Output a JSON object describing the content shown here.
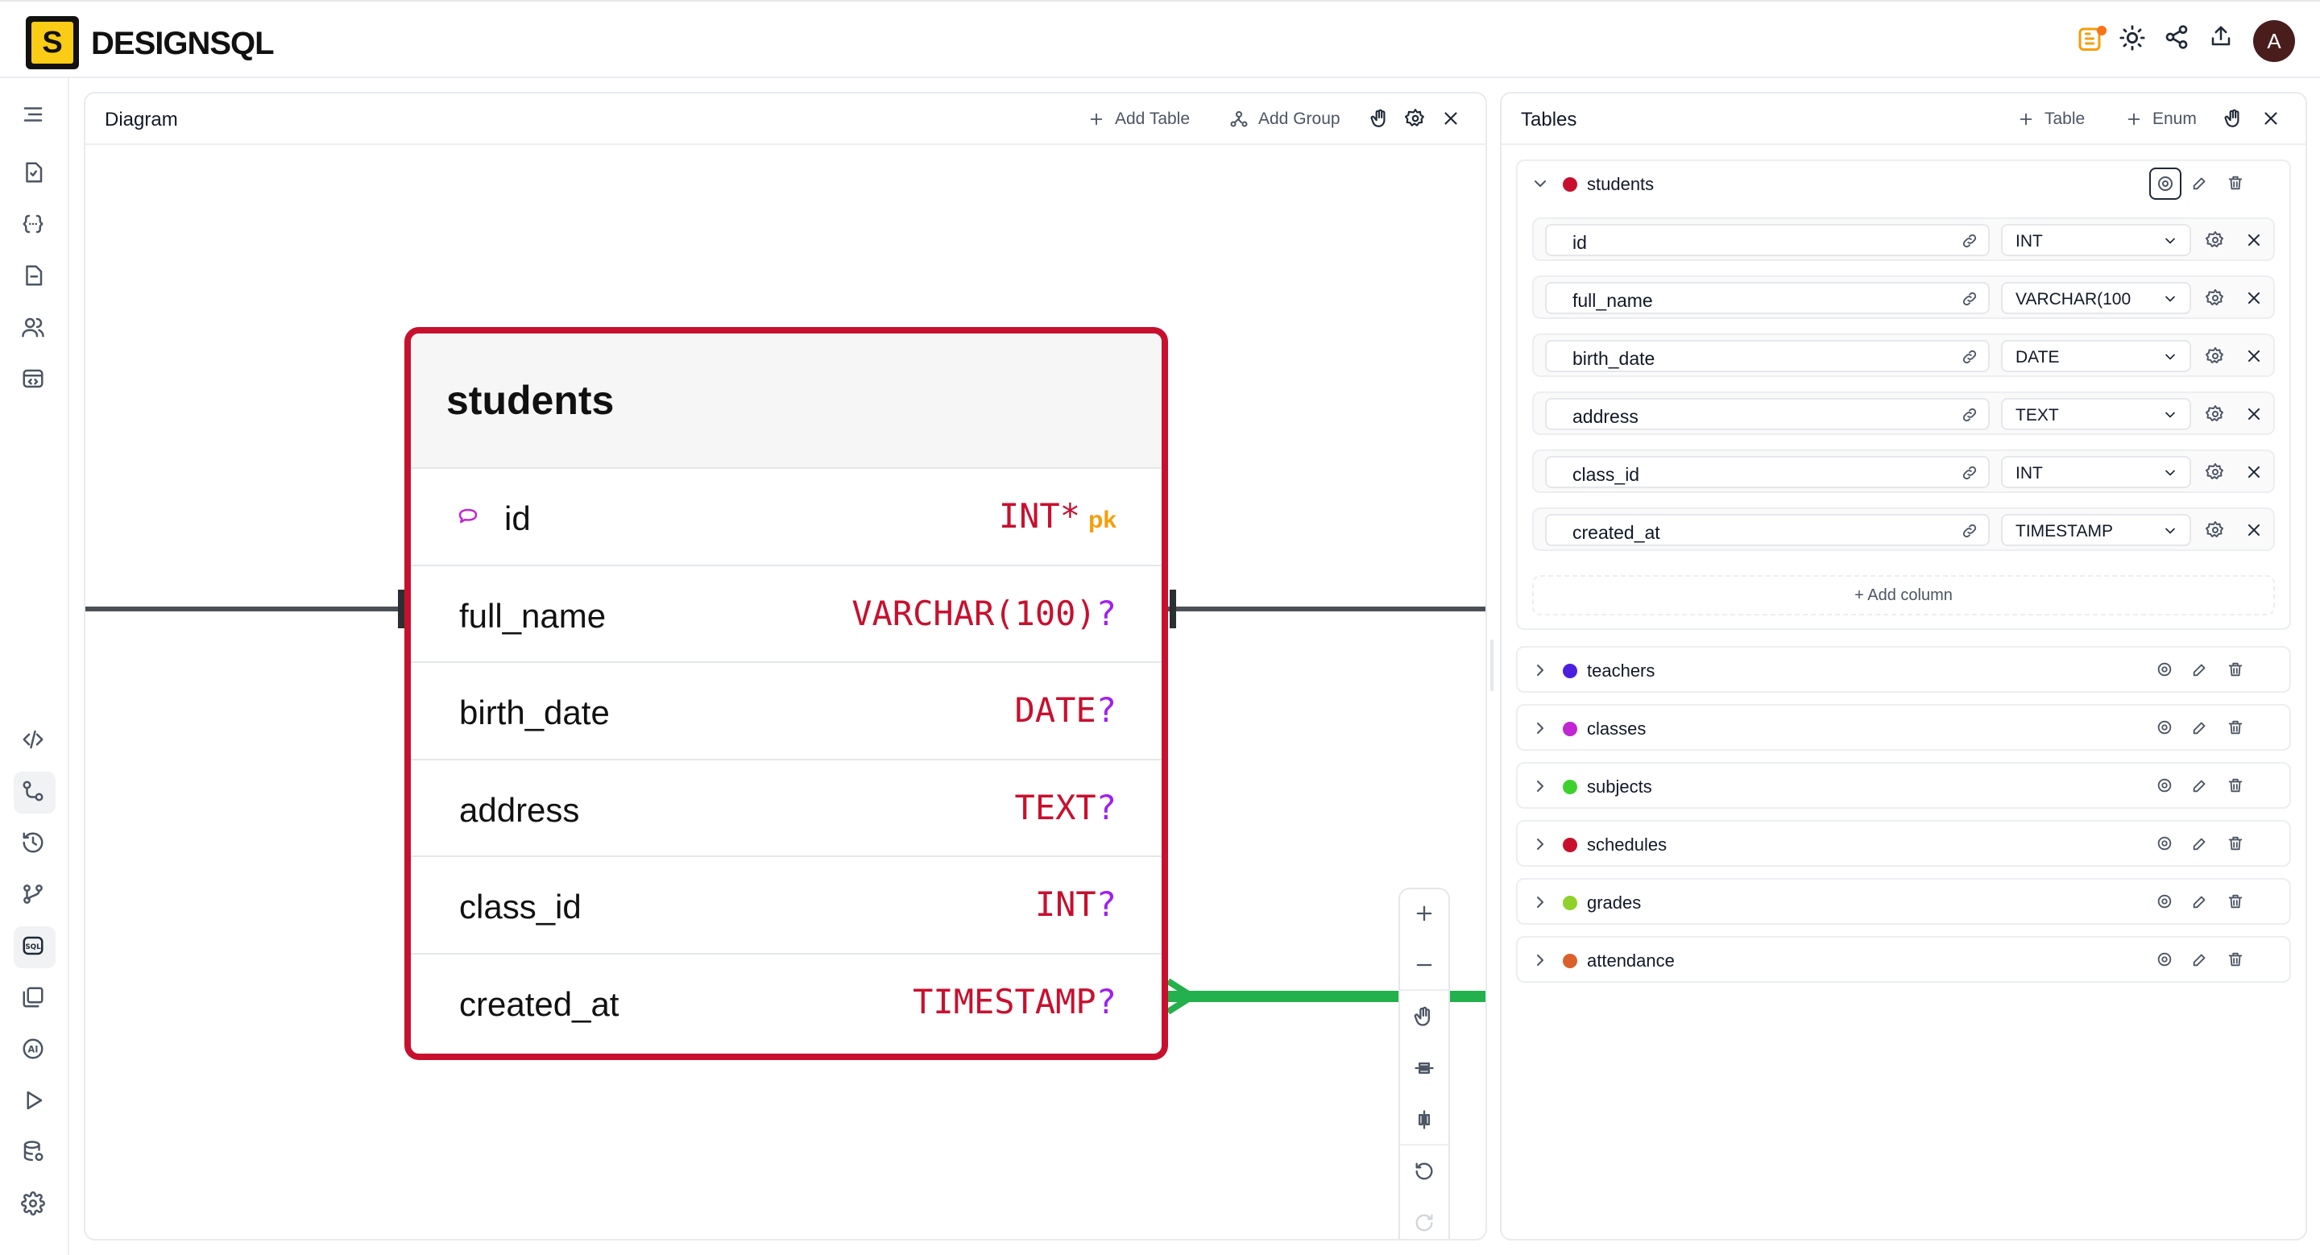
{
  "app": {
    "logo_letter": "S",
    "logo_text": "DESIGNSQL",
    "avatar": "A"
  },
  "diagram": {
    "title": "Diagram",
    "add_table": "Add Table",
    "add_group": "Add Group",
    "table": {
      "name": "students",
      "columns": [
        {
          "name": "id",
          "type": "INT",
          "suffix": "*",
          "pk": "pk"
        },
        {
          "name": "full_name",
          "type": "VARCHAR(100)",
          "suffix": "?"
        },
        {
          "name": "birth_date",
          "type": "DATE",
          "suffix": "?"
        },
        {
          "name": "address",
          "type": "TEXT",
          "suffix": "?"
        },
        {
          "name": "class_id",
          "type": "INT",
          "suffix": "?"
        },
        {
          "name": "created_at",
          "type": "TIMESTAMP",
          "suffix": "?"
        }
      ]
    },
    "colors": {
      "table_border": "#c8102e",
      "relation_green": "#22b14c",
      "relation_gray": "#4b5056"
    }
  },
  "tables_panel": {
    "title": "Tables",
    "add_table": "Table",
    "add_enum": "Enum",
    "expanded": {
      "name": "students",
      "color": "#c8102e",
      "columns": [
        {
          "name": "id",
          "type": "INT"
        },
        {
          "name": "full_name",
          "type": "VARCHAR(100"
        },
        {
          "name": "birth_date",
          "type": "DATE"
        },
        {
          "name": "address",
          "type": "TEXT"
        },
        {
          "name": "class_id",
          "type": "INT"
        },
        {
          "name": "created_at",
          "type": "TIMESTAMP"
        }
      ],
      "add_column": "Add column"
    },
    "collapsed": [
      {
        "name": "teachers",
        "color": "#4c1ee0"
      },
      {
        "name": "classes",
        "color": "#c026d3"
      },
      {
        "name": "subjects",
        "color": "#3dd12e"
      },
      {
        "name": "schedules",
        "color": "#c8102e"
      },
      {
        "name": "grades",
        "color": "#8fd12a"
      },
      {
        "name": "attendance",
        "color": "#d9622b"
      }
    ]
  }
}
